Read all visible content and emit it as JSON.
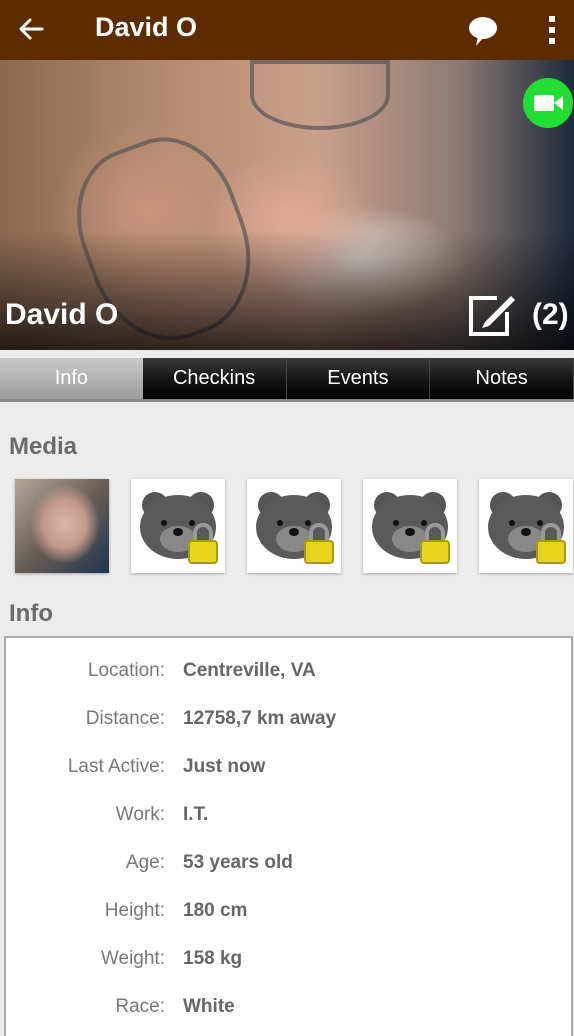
{
  "appbar": {
    "title": "David O",
    "icons": {
      "back": "arrow-left-icon",
      "chat": "chat-bubble-icon",
      "more": "more-vert-icon"
    }
  },
  "profile": {
    "name": "David O",
    "edit_count": "(2)",
    "icons": {
      "video": "video-call-icon",
      "edit": "edit-note-icon"
    },
    "colors": {
      "video_badge": "#22dd33"
    }
  },
  "tabs": [
    {
      "label": "Info",
      "active": true
    },
    {
      "label": "Checkins",
      "active": false
    },
    {
      "label": "Events",
      "active": false
    },
    {
      "label": "Notes",
      "active": false
    }
  ],
  "media": {
    "title": "Media",
    "items": [
      {
        "type": "photo",
        "locked": false
      },
      {
        "type": "private-bear",
        "locked": true
      },
      {
        "type": "private-bear",
        "locked": true
      },
      {
        "type": "private-bear",
        "locked": true
      },
      {
        "type": "private-bear",
        "locked": true
      }
    ]
  },
  "info": {
    "title": "Info",
    "rows": [
      {
        "label": "Location:",
        "value": "Centreville, VA"
      },
      {
        "label": "Distance:",
        "value": "12758,7 km away"
      },
      {
        "label": "Last Active:",
        "value": "Just now"
      },
      {
        "label": "Work:",
        "value": "I.T."
      },
      {
        "label": "Age:",
        "value": "53 years old"
      },
      {
        "label": "Height:",
        "value": "180 cm"
      },
      {
        "label": "Weight:",
        "value": "158 kg"
      },
      {
        "label": "Race:",
        "value": "White"
      }
    ]
  },
  "colors": {
    "appbar": "#5c2c00",
    "background": "#ececec"
  }
}
